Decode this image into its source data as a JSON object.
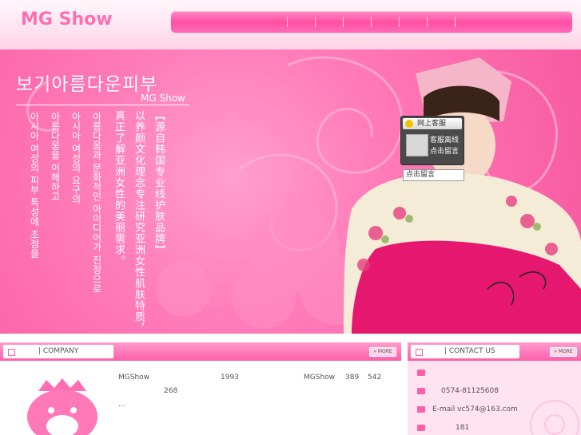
{
  "header": {
    "logo": "MG Show",
    "nav_items": [
      "",
      "",
      "",
      "",
      "",
      "",
      ""
    ]
  },
  "banner": {
    "korean_title": "보기아름다운피부",
    "brand": "MG Show",
    "korean_columns": [
      "아시아 여성의 피부 특성에 초점을",
      "아름다움을 이해하고",
      "아시아 여성의 요구의",
      "아름다움과 문화적인 아이디어가 진정으로"
    ],
    "chinese_columns": [
      "真正了解亚洲女性的美丽需求。",
      "以养颜文化理念专注研究亚洲女性肌肤特质，",
      "【源自韩国专业线护肤品牌】"
    ]
  },
  "chat": {
    "title": "网上客服",
    "status": "客服离线",
    "leave_msg": "点击留言",
    "footer": "点击留言"
  },
  "company": {
    "tab": "| COMPANY",
    "more": "» MORE",
    "lines": [
      [
        "MGShow",
        "1993",
        "MGShow",
        "389",
        "542"
      ],
      [
        "268"
      ],
      [
        "..."
      ]
    ]
  },
  "contact": {
    "tab": "| CONTACT US",
    "more": "» MORE",
    "rows": [
      "",
      "0574-81125608",
      "E-mail vc574@163.com",
      "181"
    ]
  }
}
